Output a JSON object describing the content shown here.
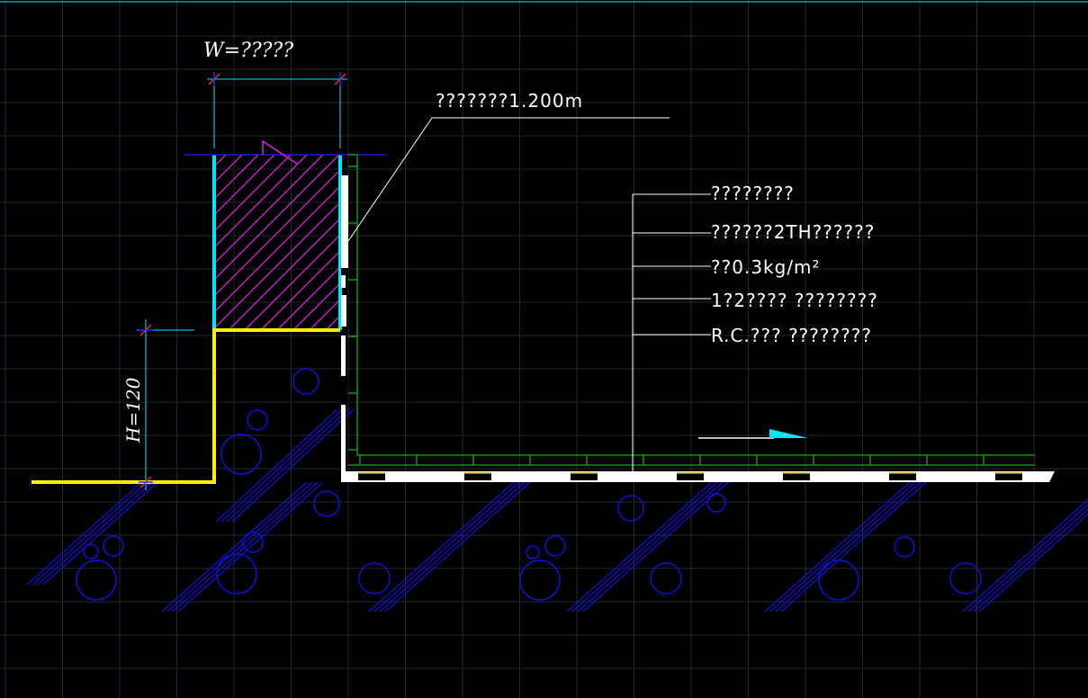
{
  "drawing": {
    "width_label": "W=?????",
    "height_label": "H=120",
    "coping_note": "???????1.200m",
    "layer_notes": [
      "????????",
      "??????2TH??????",
      "??0.3kg/m²",
      "1?2????  ????????",
      "R.C.???  ????????"
    ]
  },
  "colors": {
    "background": "#000000",
    "grid": "#1f2a33",
    "cyan": "#00e5ff",
    "yellow": "#ffee00",
    "magenta": "#e020e0",
    "blue": "#1010d8",
    "green": "#10b010",
    "white": "#ffffff"
  }
}
